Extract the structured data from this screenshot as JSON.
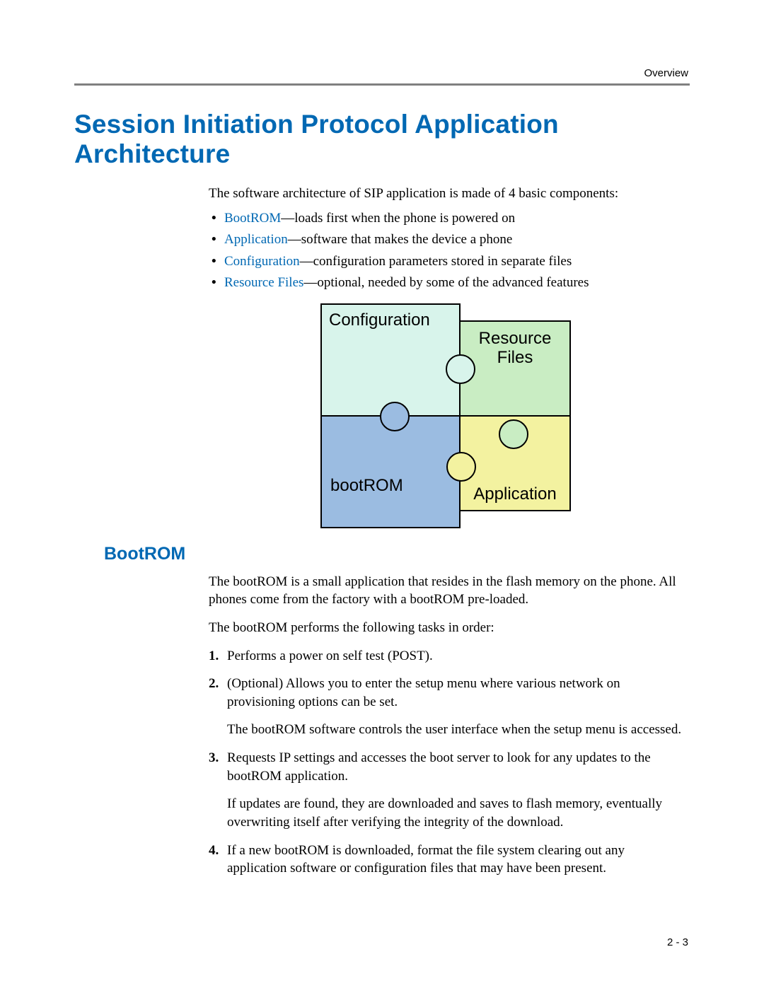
{
  "header": {
    "running_head": "Overview"
  },
  "title": "Session Initiation Protocol Application Architecture",
  "intro": "The software architecture of SIP application is made of 4 basic components:",
  "components": [
    {
      "term": "BootROM",
      "desc": "—loads first when the phone is powered on"
    },
    {
      "term": "Application",
      "desc": "—software that makes the device a phone"
    },
    {
      "term": "Configuration",
      "desc": "—configuration parameters stored in separate files"
    },
    {
      "term": "Resource Files",
      "desc": "—optional, needed by some of the advanced features"
    }
  ],
  "diagram": {
    "configuration": "Configuration",
    "resource_files": "Resource\nFiles",
    "bootrom": "bootROM",
    "application": "Application"
  },
  "section2_title": "BootROM",
  "section2_para1": "The bootROM is a small application that resides in the flash memory on the phone. All phones come from the factory with a bootROM pre-loaded.",
  "section2_para2": "The bootROM performs the following tasks in order:",
  "steps": [
    {
      "body": "Performs a power on self test (POST)."
    },
    {
      "body": "(Optional) Allows you to enter the setup menu where various network on provisioning options can be set.",
      "sub": "The bootROM software controls the user interface when the setup menu is accessed."
    },
    {
      "body": "Requests IP settings and accesses the boot server to look for any updates to the bootROM application.",
      "sub": "If updates are found, they are downloaded and saves to flash memory, eventually overwriting itself after verifying the integrity of the download."
    },
    {
      "body": "If a new bootROM is downloaded, format the file system clearing out any application software or configuration files that may have been present."
    }
  ],
  "footer": "2 - 3"
}
